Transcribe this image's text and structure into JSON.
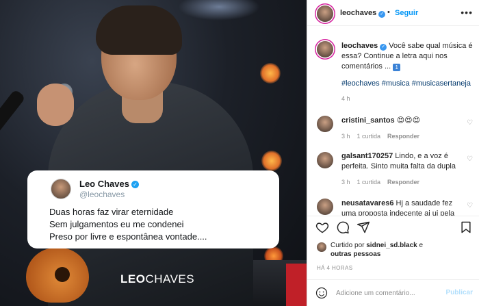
{
  "post_image": {
    "tweet": {
      "name": "Leo Chaves",
      "handle": "@leochaves",
      "lines": [
        "Duas horas faz virar eternidade",
        "Sem julgamentos eu me condenei",
        "Preso por livre e espontânea vontade...."
      ]
    },
    "brand_first": "LEO",
    "brand_second": "CHAVES"
  },
  "header": {
    "username": "leochaves",
    "separator": "•",
    "follow_label": "Seguir",
    "more_label": "•••"
  },
  "caption": {
    "username": "leochaves",
    "text": "Você sabe qual música é essa? Continue a letra aqui nos comentários ...",
    "emoji": "1",
    "hashtags": "#leochaves #musica #musicasertaneja",
    "time": "4 h"
  },
  "comments": [
    {
      "username": "cristini_santos",
      "text": "😍😍😍",
      "time": "3 h",
      "likes": "1 curtida",
      "reply": "Responder"
    },
    {
      "username": "galsant170257",
      "text": "Lindo, e a voz é perfeita. Sinto muita falta da dupla",
      "time": "3 h",
      "likes": "1 curtida",
      "reply": "Responder"
    },
    {
      "username": "neusatavares6",
      "text": "Hj a saudade fez uma proposta indecente ai ui pela",
      "time": "",
      "likes": "",
      "reply": ""
    }
  ],
  "likes": {
    "prefix": "Curtido por",
    "user": "sidnei_sd.black",
    "middle": "e",
    "others": "outras pessoas"
  },
  "time_ago": "HÁ 4 HORAS",
  "comment_input": {
    "placeholder": "Adicione um comentário...",
    "publish_label": "Publicar"
  },
  "colors": {
    "accent_blue": "#0095f6",
    "publish_disabled": "#b2dffc",
    "verified_blue": "#3897f0"
  }
}
